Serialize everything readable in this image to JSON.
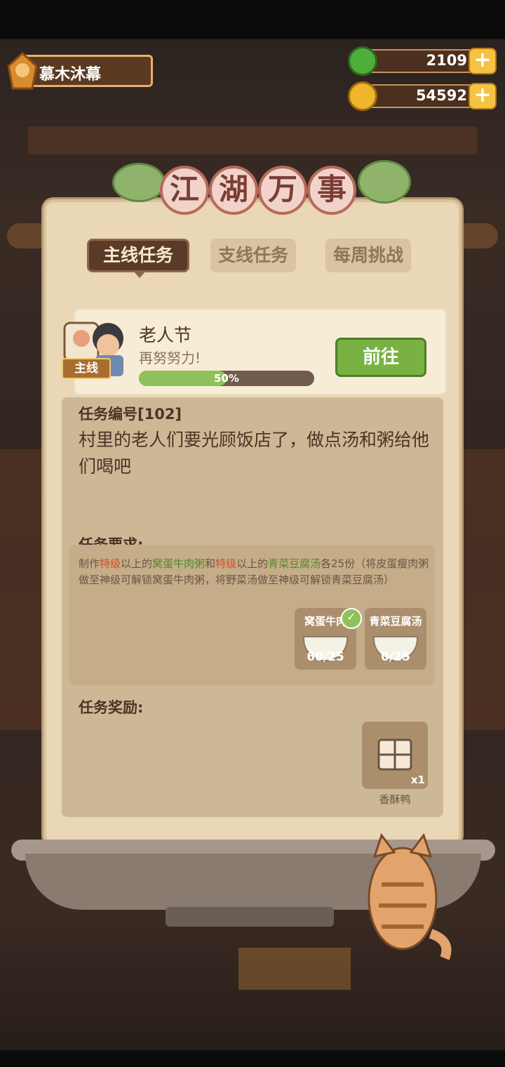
{
  "player": {
    "name": "慕木沐幕"
  },
  "resources": [
    {
      "value": "2109",
      "color": "#4fae3a"
    },
    {
      "value": "54592",
      "color": "#f0b62a"
    }
  ],
  "panel_title": [
    "江",
    "湖",
    "万",
    "事"
  ],
  "tabs": [
    {
      "label": "主线任务",
      "active": true
    },
    {
      "label": "支线任务",
      "active": false
    },
    {
      "label": "每周挑战",
      "active": false
    }
  ],
  "task": {
    "badge": "主线",
    "name": "老人节",
    "subtitle": "再努努力!",
    "progress_percent": 50,
    "progress_label": "50%",
    "go_button": "前往"
  },
  "detail": {
    "number_label": "任务编号[102]",
    "description": "村里的老人们要光顾饭店了，做点汤和粥给他们喝吧"
  },
  "requirements": {
    "label": "任务要求:",
    "text_parts": [
      {
        "t": "制作",
        "c": ""
      },
      {
        "t": "特级",
        "c": "red"
      },
      {
        "t": "以上的",
        "c": ""
      },
      {
        "t": "窝蛋牛肉粥",
        "c": "green"
      },
      {
        "t": "和",
        "c": ""
      },
      {
        "t": "特级",
        "c": "red"
      },
      {
        "t": "以上的",
        "c": ""
      },
      {
        "t": "青菜豆腐汤",
        "c": "green"
      },
      {
        "t": "各25份（将皮蛋瘦肉粥做至神级可解锁窝蛋牛肉粥，将野菜汤做至神级可解锁青菜豆腐汤）",
        "c": ""
      }
    ],
    "items": [
      {
        "name": "窝蛋牛肉",
        "count": "60/25",
        "done": true
      },
      {
        "name": "青菜豆腐汤",
        "count": "0/25",
        "done": false
      }
    ]
  },
  "rewards": {
    "label": "任务奖励:",
    "items": [
      {
        "name": "香酥鸭",
        "count": "x1"
      }
    ]
  }
}
